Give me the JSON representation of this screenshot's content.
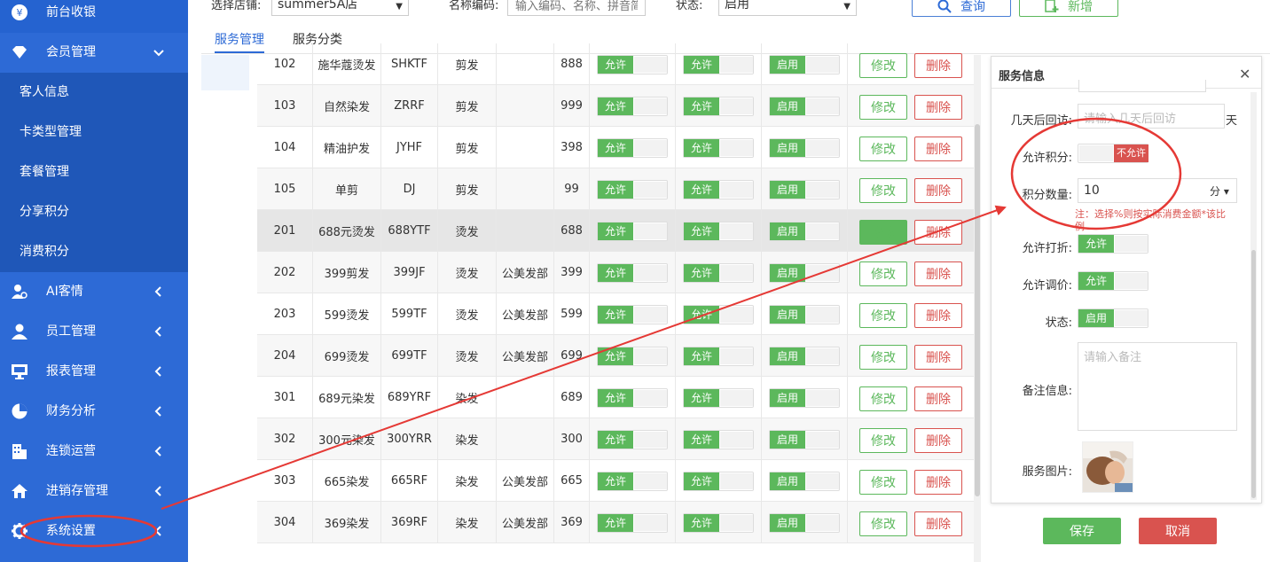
{
  "sidebar": {
    "items": [
      {
        "label": "前台收银",
        "icon": "yen-icon",
        "top": true
      },
      {
        "label": "会员管理",
        "icon": "diamond-icon",
        "expanded": true
      },
      {
        "label": "客人信息",
        "sub": true
      },
      {
        "label": "卡类型管理",
        "sub": true
      },
      {
        "label": "套餐管理",
        "sub": true
      },
      {
        "label": "分享积分",
        "sub": true
      },
      {
        "label": "消费积分",
        "sub": true
      },
      {
        "label": "AI客情",
        "icon": "ai-user-icon"
      },
      {
        "label": "员工管理",
        "icon": "user-icon"
      },
      {
        "label": "报表管理",
        "icon": "monitor-icon"
      },
      {
        "label": "财务分析",
        "icon": "pie-chart-icon"
      },
      {
        "label": "连锁运营",
        "icon": "building-icon"
      },
      {
        "label": "进销存管理",
        "icon": "home-icon"
      },
      {
        "label": "系统设置",
        "icon": "gear-icon"
      }
    ]
  },
  "toolbar": {
    "store_label": "选择店铺:",
    "store_value": "summer5A店",
    "name_label": "名称编码:",
    "name_placeholder": "输入编码、名称、拼音简",
    "status_label": "状态:",
    "status_value": "启用",
    "query_label": "查询",
    "add_label": "新增"
  },
  "tabs": [
    {
      "label": "服务管理",
      "active": true
    },
    {
      "label": "服务分类",
      "active": false
    }
  ],
  "table": {
    "rows": [
      {
        "code": "102",
        "name": "施华蔻烫发",
        "abbr": "SHKTF",
        "category": "剪发",
        "dept": "",
        "price": "888"
      },
      {
        "code": "103",
        "name": "自然染发",
        "abbr": "ZRRF",
        "category": "剪发",
        "dept": "",
        "price": "999"
      },
      {
        "code": "104",
        "name": "精油护发",
        "abbr": "JYHF",
        "category": "剪发",
        "dept": "",
        "price": "398"
      },
      {
        "code": "105",
        "name": "单剪",
        "abbr": "DJ",
        "category": "剪发",
        "dept": "",
        "price": "99"
      },
      {
        "code": "201",
        "name": "688元烫发",
        "abbr": "688YTF",
        "category": "烫发",
        "dept": "",
        "price": "688"
      },
      {
        "code": "202",
        "name": "399剪发",
        "abbr": "399JF",
        "category": "烫发",
        "dept": "公美发部",
        "price": "399"
      },
      {
        "code": "203",
        "name": "599烫发",
        "abbr": "599TF",
        "category": "烫发",
        "dept": "公美发部",
        "price": "599"
      },
      {
        "code": "204",
        "name": "699烫发",
        "abbr": "699TF",
        "category": "烫发",
        "dept": "公美发部",
        "price": "699"
      },
      {
        "code": "301",
        "name": "689元染发",
        "abbr": "689YRF",
        "category": "染发",
        "dept": "",
        "price": "689"
      },
      {
        "code": "302",
        "name": "300元染发",
        "abbr": "300YRR",
        "category": "染发",
        "dept": "",
        "price": "300"
      },
      {
        "code": "303",
        "name": "665染发",
        "abbr": "665RF",
        "category": "染发",
        "dept": "公美发部",
        "price": "665"
      },
      {
        "code": "304",
        "name": "369染发",
        "abbr": "369RF",
        "category": "染发",
        "dept": "公美发部",
        "price": "369"
      }
    ],
    "allow_label": "允许",
    "enable_label": "启用",
    "edit_label": "修改",
    "delete_label": "删除"
  },
  "dialog": {
    "title": "服务信息",
    "revisit_label": "几天后回访:",
    "revisit_placeholder": "请输入几天后回访",
    "revisit_unit": "天",
    "allow_points_label": "允许积分:",
    "allow_points_value": "不允许",
    "points_qty_label": "积分数量:",
    "points_qty_value": "10",
    "points_unit": "分",
    "points_note": "注：选择%则按实际消费金额*该比例",
    "allow_discount_label": "允许打折:",
    "allow_discount_value": "允许",
    "allow_adjust_label": "允许调价:",
    "allow_adjust_value": "允许",
    "status_label": "状态:",
    "status_value": "启用",
    "remark_label": "备注信息:",
    "remark_placeholder": "请输入备注",
    "image_label": "服务图片:"
  },
  "actions": {
    "save_label": "保存",
    "cancel_label": "取消"
  },
  "colors": {
    "sidebar_bg": "#2d6ad6",
    "accent_blue": "#2d6ad6",
    "success_green": "#5cb85c",
    "danger_red": "#d9534f",
    "annotation_red": "#e53935"
  }
}
